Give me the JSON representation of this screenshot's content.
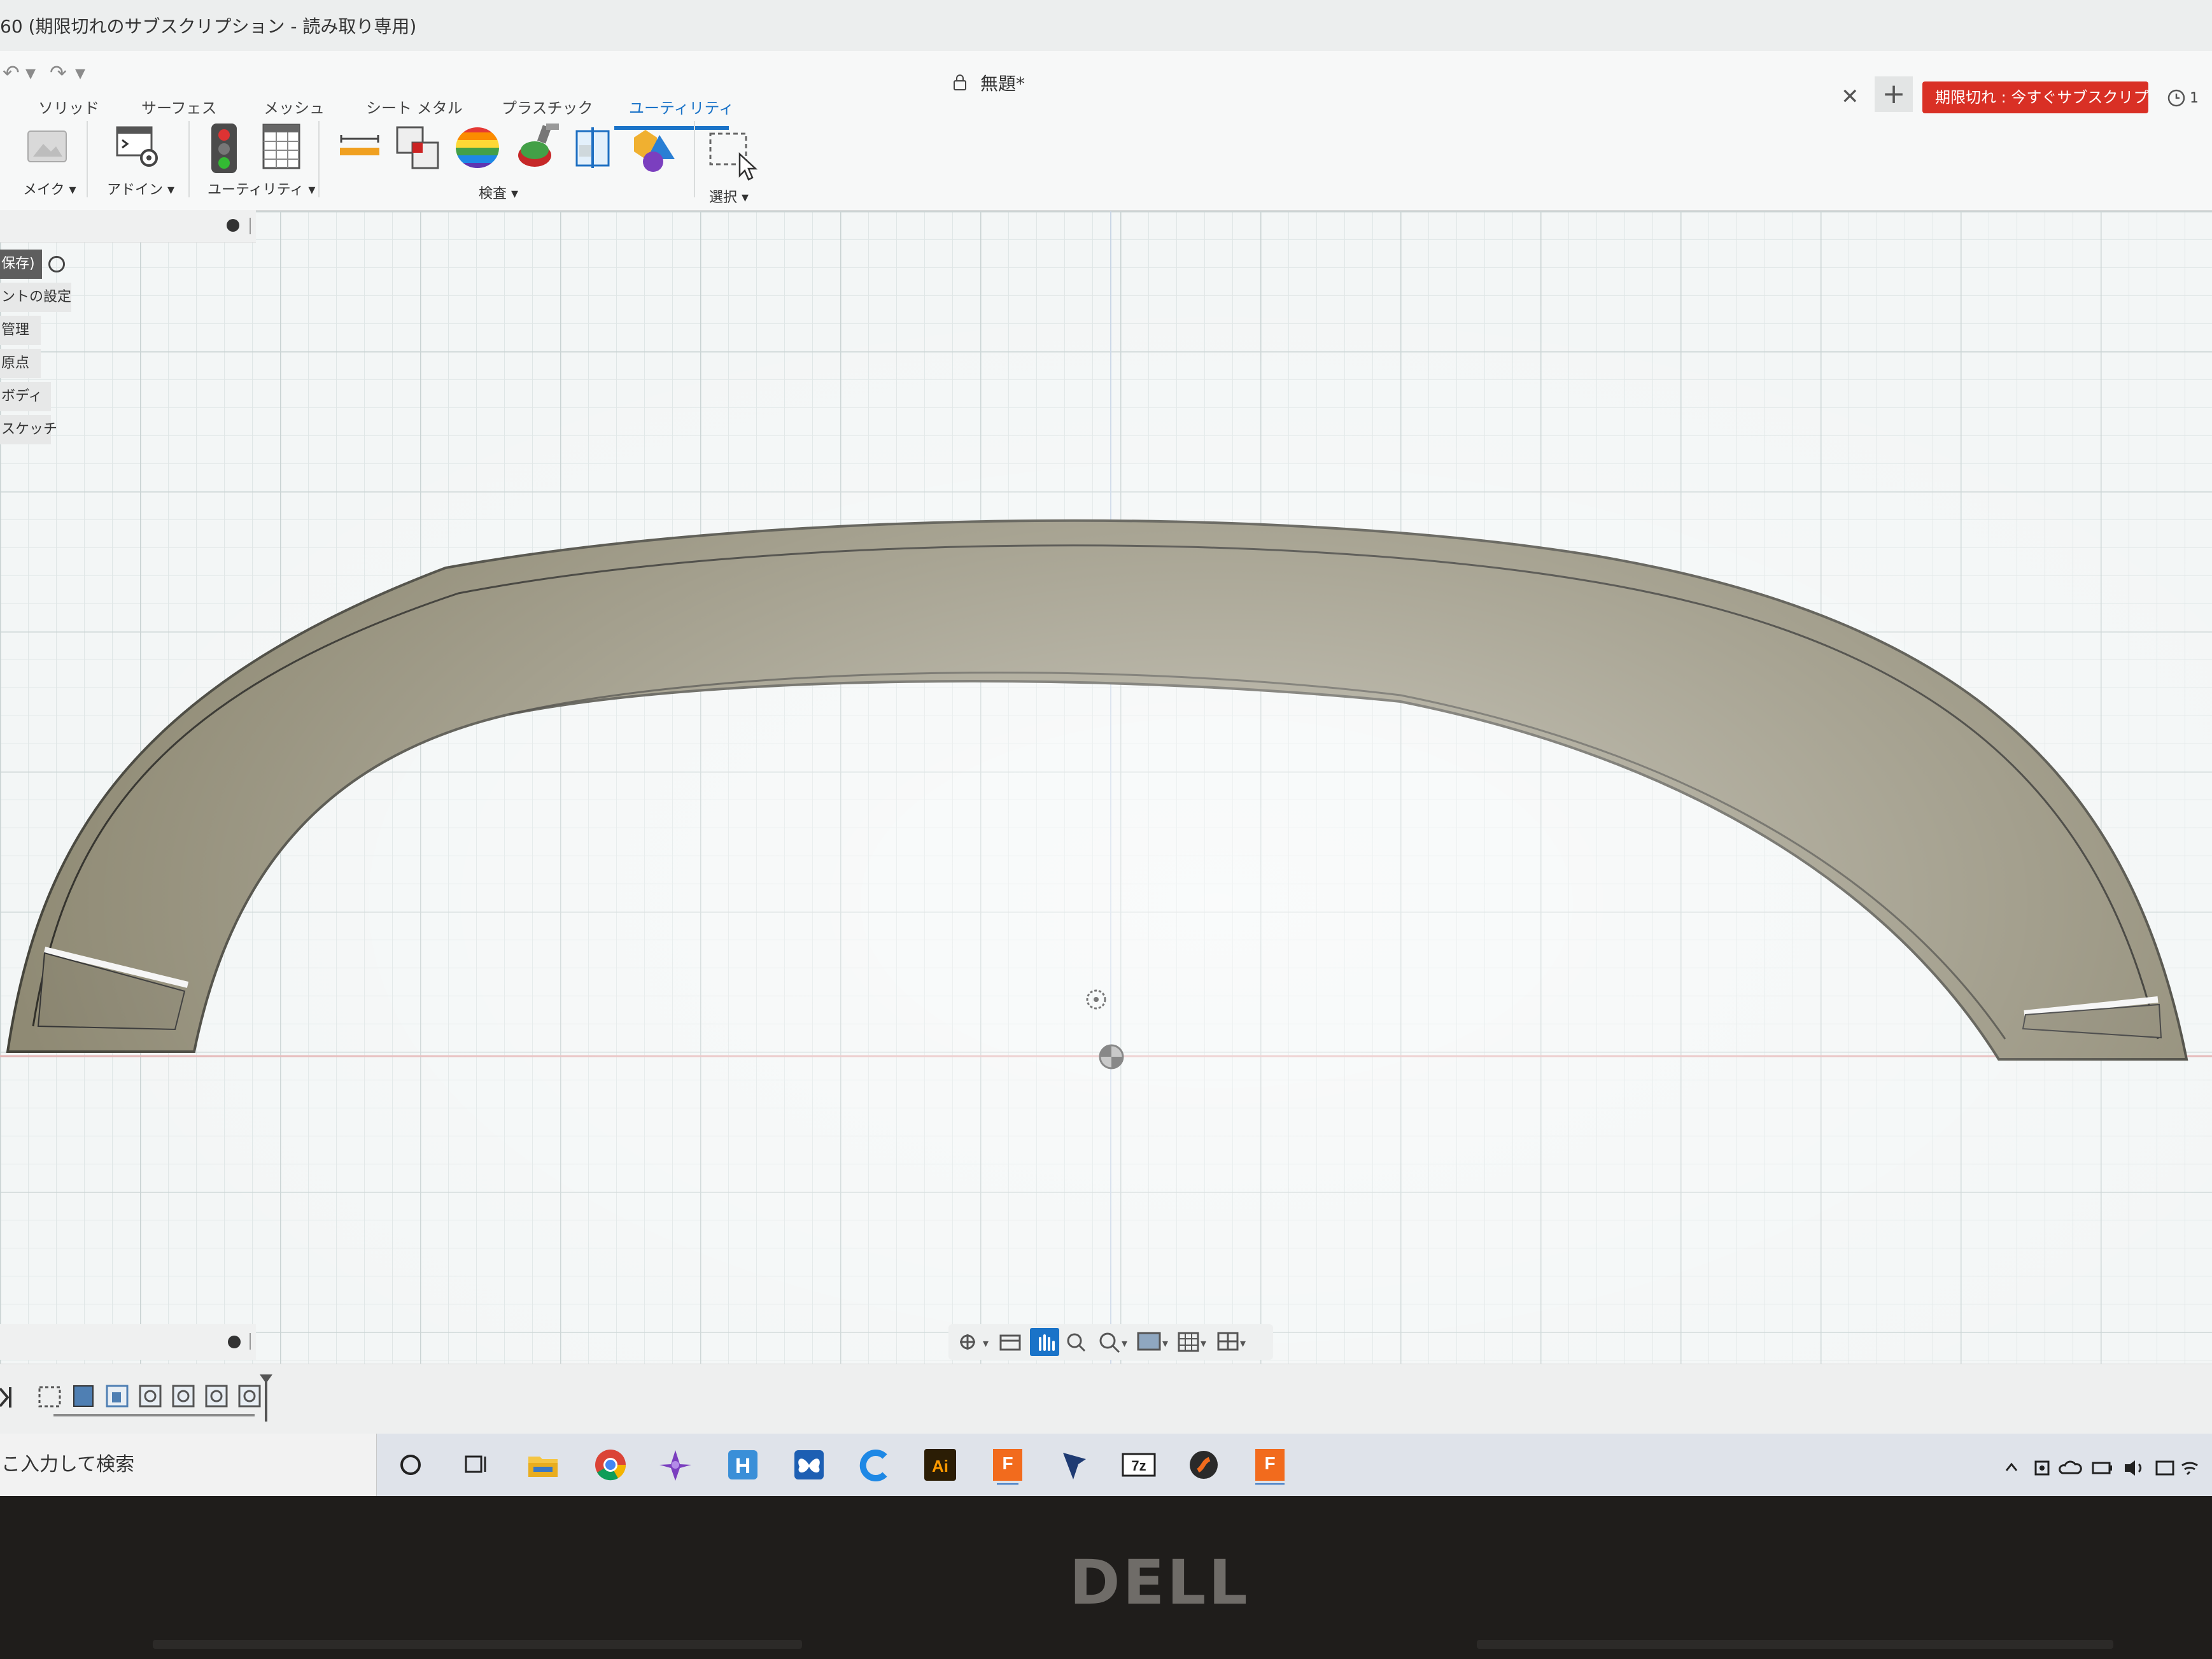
{
  "window": {
    "title": "60 (期限切れのサブスクリプション - 読み取り専用)",
    "document_title": "無題*",
    "expired_button": "期限切れ : 今すぐサブスクリプショ...",
    "notification_count": "1"
  },
  "ribbon": {
    "tabs": [
      {
        "label": "ソリッド"
      },
      {
        "label": "サーフェス"
      },
      {
        "label": "メッシュ"
      },
      {
        "label": "シート メタル"
      },
      {
        "label": "プラスチック"
      },
      {
        "label": "ユーティリティ",
        "active": true
      }
    ],
    "groups": {
      "make": "メイク ▾",
      "addins": "アドイン ▾",
      "utility": "ユーティリティ ▾",
      "inspect": "検査 ▾",
      "select": "選択 ▾"
    }
  },
  "browser": {
    "items": [
      "保存)",
      "ントの設定",
      "管理",
      "原点",
      "ボディ",
      "スケッチ"
    ]
  },
  "taskbar": {
    "search_placeholder": "こ入力して検索",
    "apps": [
      "cortana",
      "task-view",
      "file-explorer",
      "chrome",
      "affinity",
      "h-app",
      "butterfly-app",
      "c-app",
      "illustrator",
      "fusion-360",
      "v-app",
      "7zip",
      "s-app",
      "fusion-360-active"
    ]
  },
  "hardware": {
    "brand": "DELL"
  },
  "colors": {
    "accent": "#1a73c8",
    "expired": "#d93025",
    "model": "#8f8a74",
    "grid": "#dde4e4"
  }
}
